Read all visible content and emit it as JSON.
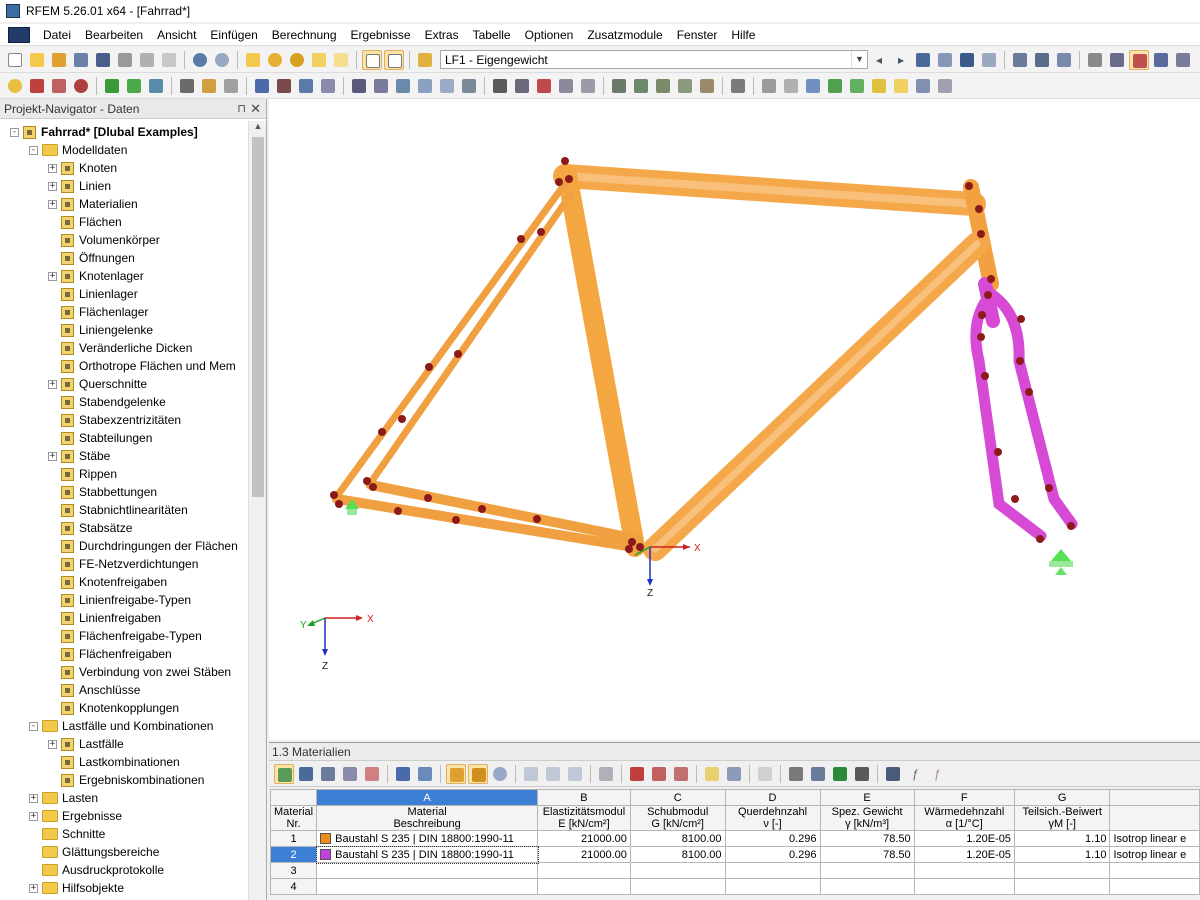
{
  "window": {
    "title": "RFEM 5.26.01 x64 - [Fahrrad*]"
  },
  "menu": [
    "Datei",
    "Bearbeiten",
    "Ansicht",
    "Einfügen",
    "Berechnung",
    "Ergebnisse",
    "Extras",
    "Tabelle",
    "Optionen",
    "Zusatzmodule",
    "Fenster",
    "Hilfe"
  ],
  "toolbar": {
    "load_case": "LF1 - Eigengewicht"
  },
  "navigator": {
    "title": "Projekt-Navigator - Daten",
    "project": "Fahrrad* [Dlubal Examples]",
    "modelldaten": "Modelldaten",
    "items": [
      "Knoten",
      "Linien",
      "Materialien",
      "Flächen",
      "Volumenkörper",
      "Öffnungen",
      "Knotenlager",
      "Linienlager",
      "Flächenlager",
      "Liniengelenke",
      "Veränderliche Dicken",
      "Orthotrope Flächen und Mem",
      "Querschnitte",
      "Stabendgelenke",
      "Stabexzentrizitäten",
      "Stabteilungen",
      "Stäbe",
      "Rippen",
      "Stabbettungen",
      "Stabnichtlinearitäten",
      "Stabsätze",
      "Durchdringungen der Flächen",
      "FE-Netzverdichtungen",
      "Knotenfreigaben",
      "Linienfreigabe-Typen",
      "Linienfreigaben",
      "Flächenfreigabe-Typen",
      "Flächenfreigaben",
      "Verbindung von zwei Stäben",
      "Anschlüsse",
      "Knotenkopplungen"
    ],
    "lastfaelle_kombinationen": "Lastfälle und Kombinationen",
    "lk_items": [
      "Lastfälle",
      "Lastkombinationen",
      "Ergebniskombinationen"
    ],
    "bottom": [
      "Lasten",
      "Ergebnisse",
      "Schnitte",
      "Glättungsbereiche",
      "Ausdruckprotokolle",
      "Hilfsobjekte"
    ]
  },
  "view": {
    "axes": {
      "x": "X",
      "y": "Y",
      "z": "Z"
    },
    "colors": {
      "frame": "#f5a53a",
      "fork": "#d64ad6",
      "node": "#8b0000",
      "support": "#55e055"
    }
  },
  "table": {
    "title": "1.3 Materialien",
    "col_letters": [
      "A",
      "B",
      "C",
      "D",
      "E",
      "F",
      "G"
    ],
    "headers": [
      [
        "Material",
        "Nr."
      ],
      [
        "Material",
        "Beschreibung"
      ],
      [
        "Elastizitätsmodul",
        "E [kN/cm²]"
      ],
      [
        "Schubmodul",
        "G [kN/cm²]"
      ],
      [
        "Querdehnzahl",
        "ν [-]"
      ],
      [
        "Spez. Gewicht",
        "γ [kN/m³]"
      ],
      [
        "Wärmedehnzahl",
        "α [1/°C]"
      ],
      [
        "Teilsich.-Beiwert",
        "γM [-]"
      ],
      [
        "",
        ""
      ]
    ],
    "rows": [
      {
        "nr": "1",
        "color": "#f08c1a",
        "desc": "Baustahl S 235 | DIN 18800:1990-11",
        "e": "21000.00",
        "g": "8100.00",
        "nu": "0.296",
        "gamma": "78.50",
        "alpha": "1.20E-05",
        "gm": "1.10",
        "model": "Isotrop linear e"
      },
      {
        "nr": "2",
        "color": "#c040e0",
        "desc": "Baustahl S 235 | DIN 18800:1990-11",
        "e": "21000.00",
        "g": "8100.00",
        "nu": "0.296",
        "gamma": "78.50",
        "alpha": "1.20E-05",
        "gm": "1.10",
        "model": "Isotrop linear e"
      },
      {
        "nr": "3",
        "color": "",
        "desc": "",
        "e": "",
        "g": "",
        "nu": "",
        "gamma": "",
        "alpha": "",
        "gm": "",
        "model": ""
      },
      {
        "nr": "4",
        "color": "",
        "desc": "",
        "e": "",
        "g": "",
        "nu": "",
        "gamma": "",
        "alpha": "",
        "gm": "",
        "model": ""
      }
    ]
  }
}
